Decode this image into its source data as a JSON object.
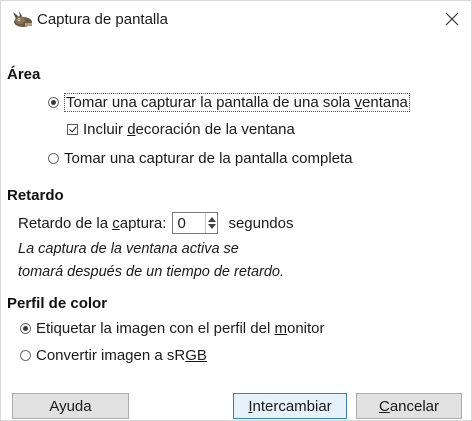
{
  "window": {
    "title": "Captura de pantalla",
    "app_icon": "gimp-wilber-icon",
    "close_icon": "close-icon"
  },
  "area": {
    "title": "Área",
    "options": [
      {
        "label_before": "Tomar una capturar la pantalla de una sola ",
        "mnemonic": "v",
        "label_after": "entana",
        "selected": true
      },
      {
        "label_before": "Tomar una capturar de la pantalla completa",
        "mnemonic": "",
        "label_after": "",
        "selected": false
      }
    ],
    "decoration": {
      "label_before": "Incluir ",
      "mnemonic": "d",
      "label_after": "ecoración de la ventana",
      "checked": true
    }
  },
  "delay": {
    "title": "Retardo",
    "label_before": "Retardo de la ",
    "mnemonic": "c",
    "label_after": "aptura:",
    "value": "0",
    "unit": "segundos",
    "note_line1": "La captura de la ventana activa se",
    "note_line2": "tomará después de un tiempo de retardo."
  },
  "color_profile": {
    "title": "Perfil de color",
    "options": [
      {
        "label_before": "Etiquetar la imagen con el perfil del ",
        "mnemonic": "m",
        "label_after": "onitor",
        "selected": true
      },
      {
        "label_before": "Convertir imagen a sR",
        "mnemonic": "GB",
        "label_after": "",
        "selected": false
      }
    ]
  },
  "buttons": {
    "help": "Ayuda",
    "swap_mnemonic": "I",
    "swap_rest": "ntercambiar",
    "cancel_mnemonic": "C",
    "cancel_rest": "ancelar"
  }
}
